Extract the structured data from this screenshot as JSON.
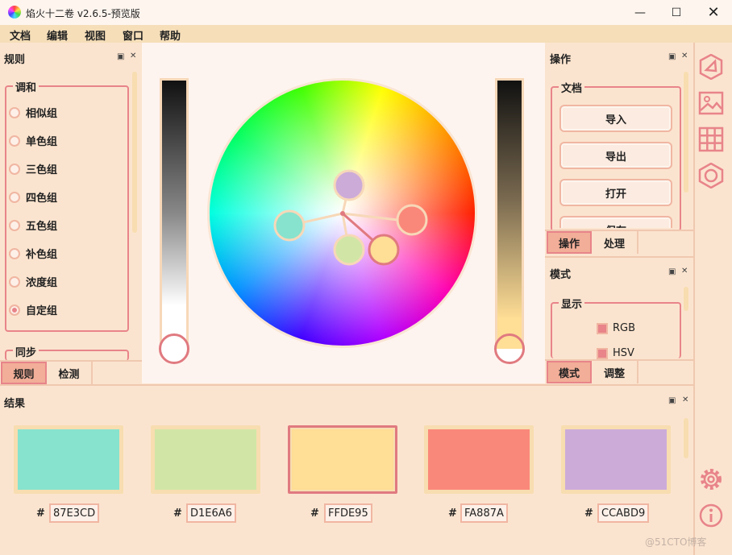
{
  "window": {
    "title": "焰火十二卷 v2.6.5-预览版",
    "controls": [
      "minimize-icon",
      "maximize-icon",
      "close-icon"
    ]
  },
  "menu": [
    "文档",
    "编辑",
    "视图",
    "窗口",
    "帮助"
  ],
  "rules_panel": {
    "title": "规则",
    "harmony_group": {
      "title": "调和",
      "options": [
        "相似组",
        "单色组",
        "三色组",
        "四色组",
        "五色组",
        "补色组",
        "浓度组",
        "自定组"
      ],
      "selected": "自定组"
    },
    "sync_group_title": "同步",
    "tabs": [
      "规则",
      "检测"
    ],
    "active_tab": "规则"
  },
  "ops_panel": {
    "title": "操作",
    "doc_group_title": "文档",
    "buttons": [
      "导入",
      "导出",
      "打开",
      "保存"
    ],
    "tabs": [
      "操作",
      "处理"
    ],
    "active_tab": "操作"
  },
  "mode_panel": {
    "title": "模式",
    "display_group_title": "显示",
    "checks": [
      {
        "label": "RGB",
        "checked": true
      },
      {
        "label": "HSV",
        "checked": true
      }
    ],
    "tabs": [
      "模式",
      "调整"
    ],
    "active_tab": "模式"
  },
  "results_panel": {
    "title": "结果",
    "hash": "#",
    "swatches": [
      {
        "hex": "87E3CD",
        "color": "#87E3CD",
        "selected": false
      },
      {
        "hex": "D1E6A6",
        "color": "#D1E6A6",
        "selected": false
      },
      {
        "hex": "FFDE95",
        "color": "#FFDE95",
        "selected": true
      },
      {
        "hex": "FA887A",
        "color": "#FA887A",
        "selected": false
      },
      {
        "hex": "CCABD9",
        "color": "#CCABD9",
        "selected": false
      }
    ]
  },
  "wheel_nodes": [
    {
      "name": "purple",
      "color": "#CCABD9"
    },
    {
      "name": "teal",
      "color": "#87E3CD"
    },
    {
      "name": "red",
      "color": "#FA887A"
    },
    {
      "name": "lime",
      "color": "#D1E6A6"
    },
    {
      "name": "yellow",
      "color": "#FFDE95"
    }
  ],
  "side_toolbar": [
    "wheel-icon",
    "image-icon",
    "grid-icon",
    "pattern-icon",
    "settings-icon",
    "info-icon"
  ],
  "watermark": "@51CTO博客",
  "colors": {
    "accent": "#e8848a",
    "panel_bg": "#fbe4cf",
    "tab_active": "#f2ae98"
  }
}
